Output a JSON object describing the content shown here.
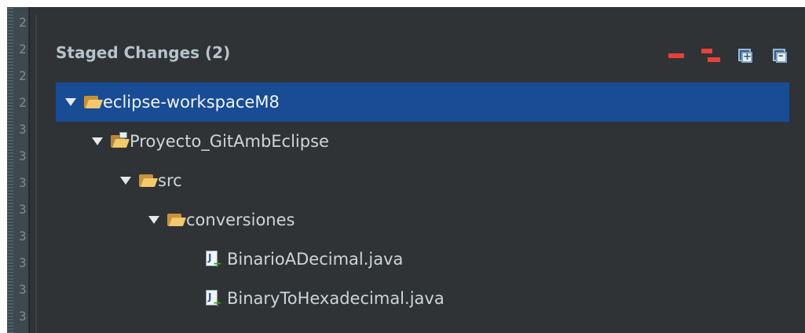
{
  "gutter": {
    "numbers": [
      "2",
      "2",
      "2",
      "2",
      "3",
      "3",
      "3",
      "3",
      "3",
      "3",
      "3",
      "3"
    ]
  },
  "panel": {
    "title": "Staged Changes (2)",
    "toolbar": [
      {
        "icon": "unstage-icon"
      },
      {
        "icon": "unstage-all-icon"
      },
      {
        "icon": "expand-all-icon"
      },
      {
        "icon": "collapse-all-icon"
      }
    ]
  },
  "tree": [
    {
      "label": "eclipse-workspaceM8",
      "type": "folder",
      "expanded": true,
      "selected": true,
      "depth": 0
    },
    {
      "label": "Proyecto_GitAmbEclipse",
      "type": "project",
      "expanded": true,
      "selected": false,
      "depth": 1
    },
    {
      "label": "src",
      "type": "folder",
      "expanded": true,
      "selected": false,
      "depth": 2
    },
    {
      "label": "conversiones",
      "type": "folder",
      "expanded": true,
      "selected": false,
      "depth": 3
    },
    {
      "label": "BinarioADecimal.java",
      "type": "java-added",
      "selected": false,
      "depth": 4
    },
    {
      "label": "BinaryToHexadecimal.java",
      "type": "java-added",
      "selected": false,
      "depth": 4
    }
  ],
  "colors": {
    "background": "#2f3335",
    "selection": "#184c95",
    "title": "#b7c3ca",
    "text": "#cdd5da",
    "danger": "#e8413a"
  }
}
